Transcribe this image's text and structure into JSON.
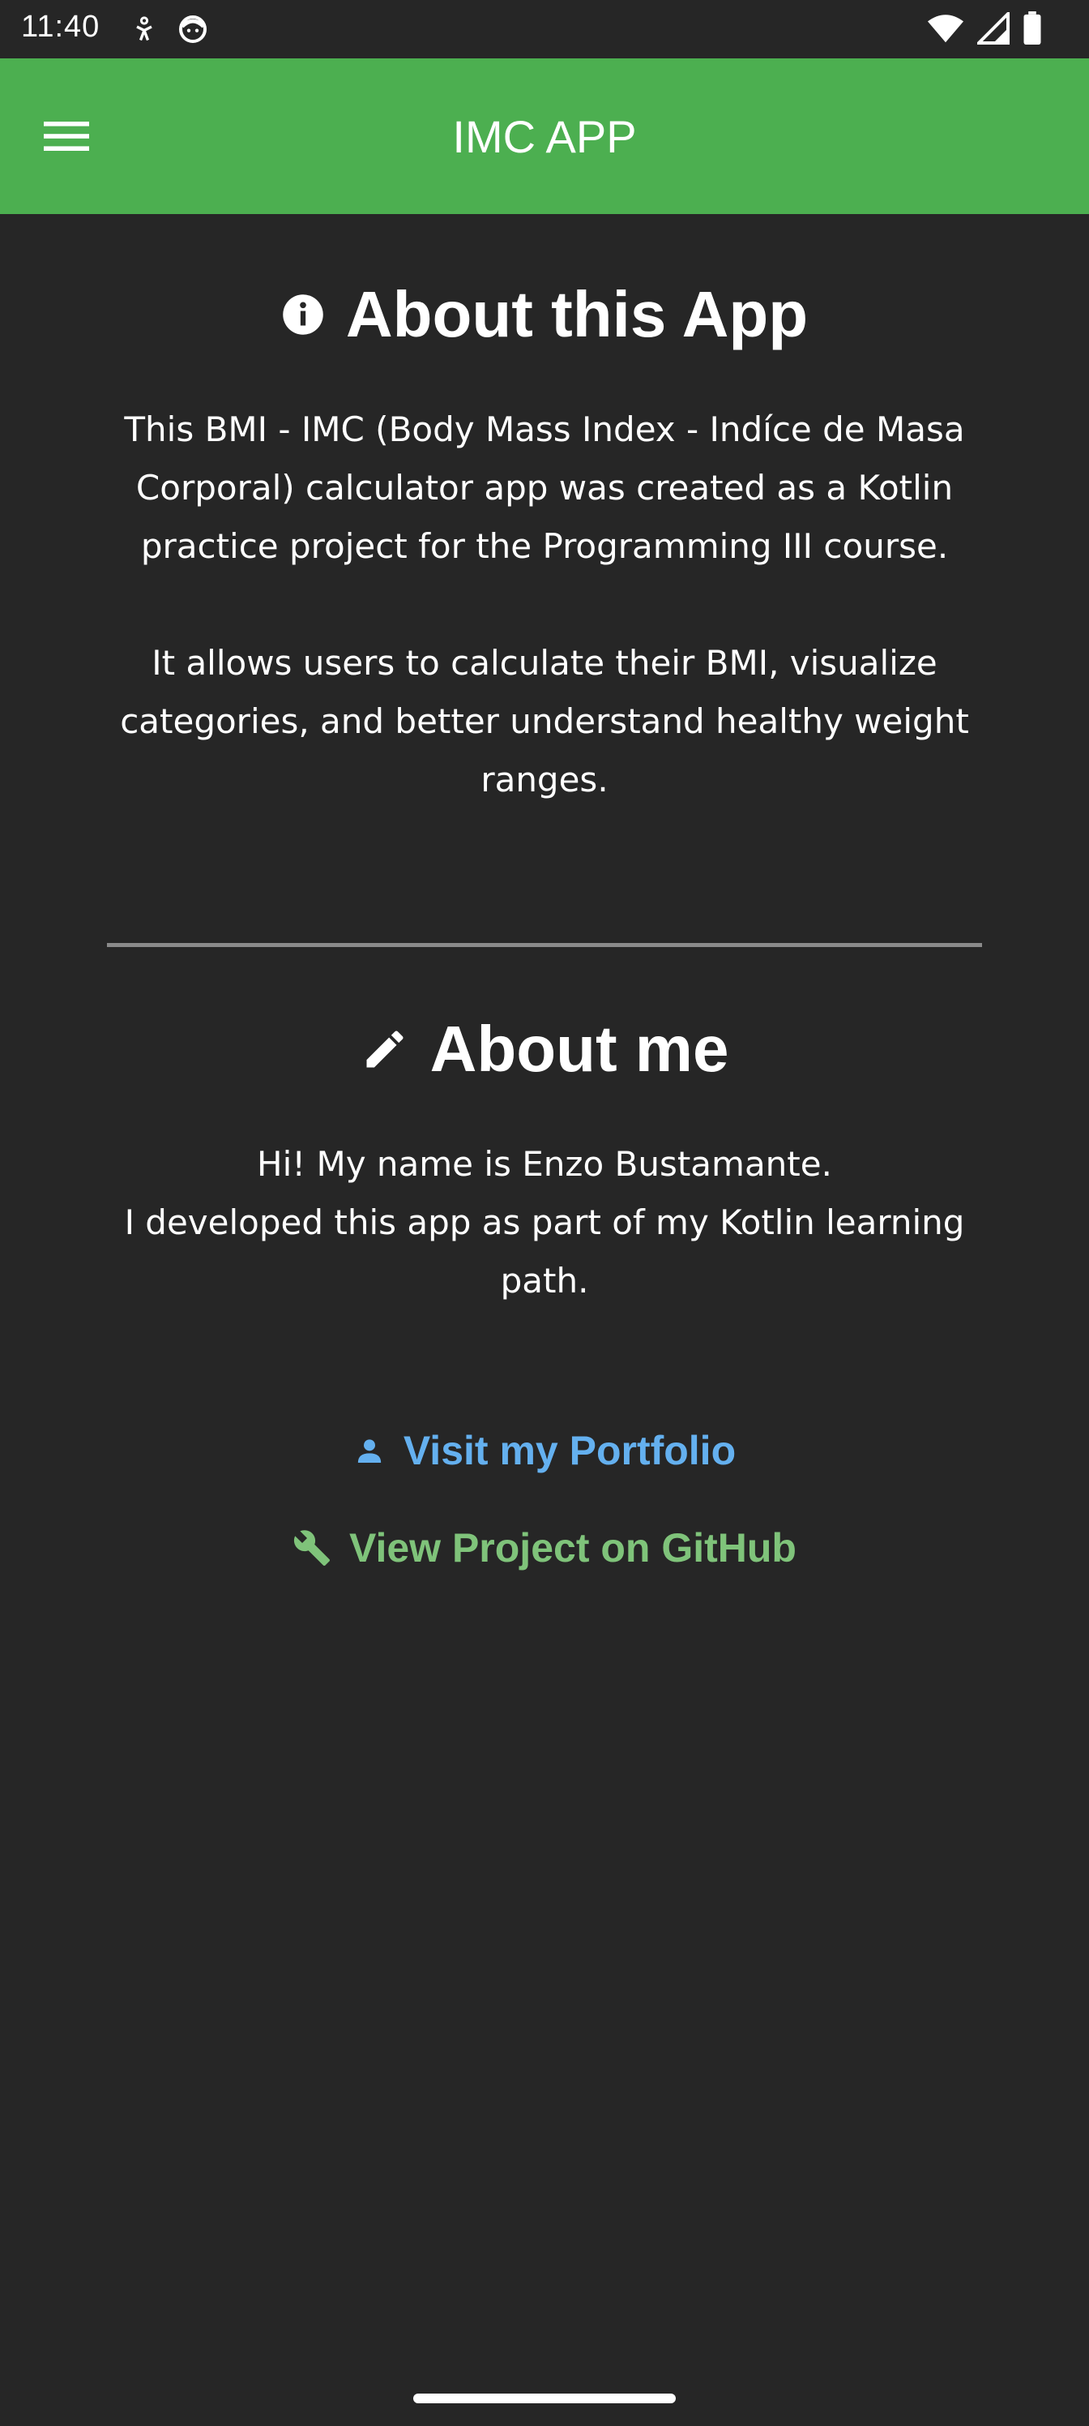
{
  "status_bar": {
    "time": "11:40"
  },
  "app_bar": {
    "title": "IMC APP",
    "menu_icon": "hamburger-menu-icon"
  },
  "about_app": {
    "icon": "info-icon",
    "title": "About this App",
    "paragraph1_lines": [
      "This BMI - IMC (Body Mass Index - Indíce de Masa",
      "Corporal) calculator app was created as a Kotlin",
      "practice project for the Programming III course."
    ],
    "paragraph2_lines": [
      "It allows users to calculate their BMI, visualize",
      "categories, and better understand healthy weight",
      "ranges."
    ]
  },
  "about_me": {
    "icon": "pencil-icon",
    "title": "About me",
    "lines": [
      "Hi! My name is Enzo Bustamante.",
      "I developed this app as part of my Kotlin learning",
      "path."
    ]
  },
  "links": {
    "portfolio_label": "Visit my Portfolio",
    "portfolio_icon": "person-icon",
    "github_label": "View Project on GitHub",
    "github_icon": "wrench-icon"
  },
  "colors": {
    "app_bar": "#4caf50",
    "background": "#262626",
    "portfolio_link": "#64b0ef",
    "github_link": "#7fc37a"
  }
}
